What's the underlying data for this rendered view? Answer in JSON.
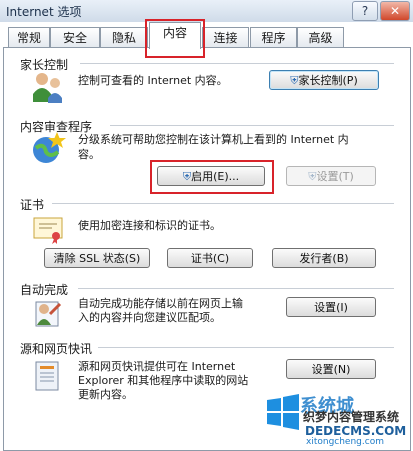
{
  "window": {
    "title": "Internet 选项",
    "help_glyph": "?",
    "close_glyph": "✕"
  },
  "tabs": [
    {
      "label": "常规"
    },
    {
      "label": "安全"
    },
    {
      "label": "隐私"
    },
    {
      "label": "内容"
    },
    {
      "label": "连接"
    },
    {
      "label": "程序"
    },
    {
      "label": "高级"
    }
  ],
  "active_tab": "内容",
  "sections": {
    "parental": {
      "title": "家长控制",
      "desc": "控制可查看的 Internet 内容。",
      "button": "家长控制(P)"
    },
    "advisor": {
      "title": "内容审查程序",
      "desc_line1": "分级系统可帮助您控制在该计算机上看到的 Internet 内",
      "desc_line2": "容。",
      "enable_button": "启用(E)...",
      "settings_button": "设置(T)"
    },
    "certificates": {
      "title": "证书",
      "desc": "使用加密连接和标识的证书。",
      "clear_ssl_button": "清除 SSL 状态(S)",
      "certs_button": "证书(C)",
      "publishers_button": "发行者(B)"
    },
    "autocomplete": {
      "title": "自动完成",
      "desc_line1": "自动完成功能存储以前在网页上输",
      "desc_line2": "入的内容并向您建议匹配项。",
      "settings_button": "设置(I)"
    },
    "feeds": {
      "title": "源和网页快讯",
      "desc_line1": "源和网页快讯提供可在 Internet",
      "desc_line2": "Explorer 和其他程序中读取的网站",
      "desc_line3": "更新内容。",
      "settings_button": "设置(N)"
    }
  },
  "watermark": {
    "brand": "系统城",
    "site": "xitongcheng.com",
    "text1": "织梦内容管理系统",
    "text2": "DEDECMS.COM"
  },
  "colors": {
    "highlight_red": "#d8232a",
    "button_blue_border": "#3c7fb1"
  }
}
